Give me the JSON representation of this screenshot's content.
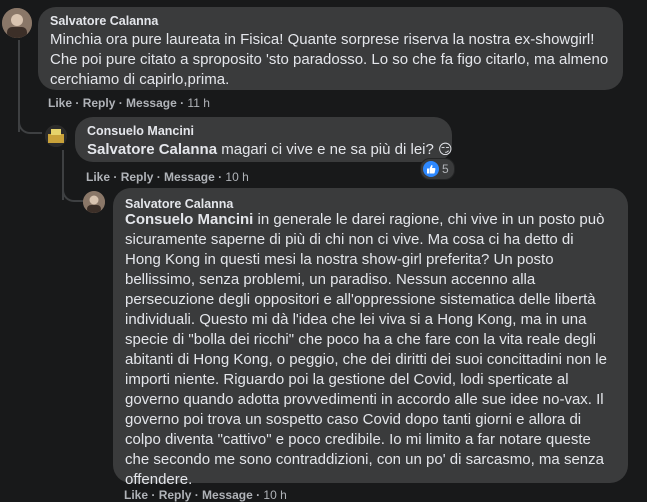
{
  "comments": [
    {
      "author": "Salvatore Calanna",
      "text": "Minchia ora pure laureata in Fisica! Quante sorprese riserva la nostra ex-showgirl! Che poi pure citato a sproposito 'sto paradosso. Lo so che fa figo citarlo, ma almeno cerchiamo di capirlo,prima.",
      "actions": {
        "like": "Like",
        "reply": "Reply",
        "message": "Message",
        "time": "11 h"
      }
    },
    {
      "author": "Consuelo Mancini",
      "mention": "Salvatore Calanna",
      "text": " magari ci vive e ne sa più di lei? ",
      "emoji": "😏",
      "reaction_count": "5",
      "actions": {
        "like": "Like",
        "reply": "Reply",
        "message": "Message",
        "time": "10 h"
      }
    },
    {
      "author": "Salvatore Calanna",
      "mention": "Consuelo Mancini",
      "text": " in generale le darei ragione, chi vive in un posto può sicuramente saperne di più di chi non ci vive. Ma cosa ci ha detto di Hong Kong in questi mesi la nostra show-girl preferita? Un posto bellissimo, senza problemi, un paradiso. Nessun accenno alla persecuzione degli oppositori e all'oppressione sistematica delle libertà individuali. Questo mi dà l'idea che lei viva si a Hong Kong, ma in una specie di \"bolla dei ricchi\" che poco ha a che fare con la vita reale degli abitanti di Hong Kong, o peggio, che dei diritti dei suoi concittadini non le importi niente. Riguardo poi la gestione del Covid, lodi sperticate al governo quando adotta provvedimenti in accordo alle sue idee no-vax. Il governo poi trova un sospetto caso Covid dopo tanti giorni e allora di colpo diventa \"cattivo\" e poco credibile. Io mi limito a far notare queste che secondo me sono contraddizioni, con un po' di sarcasmo, ma senza offendere.",
      "actions": {
        "like": "Like",
        "reply": "Reply",
        "message": "Message",
        "time": "10 h"
      }
    }
  ]
}
